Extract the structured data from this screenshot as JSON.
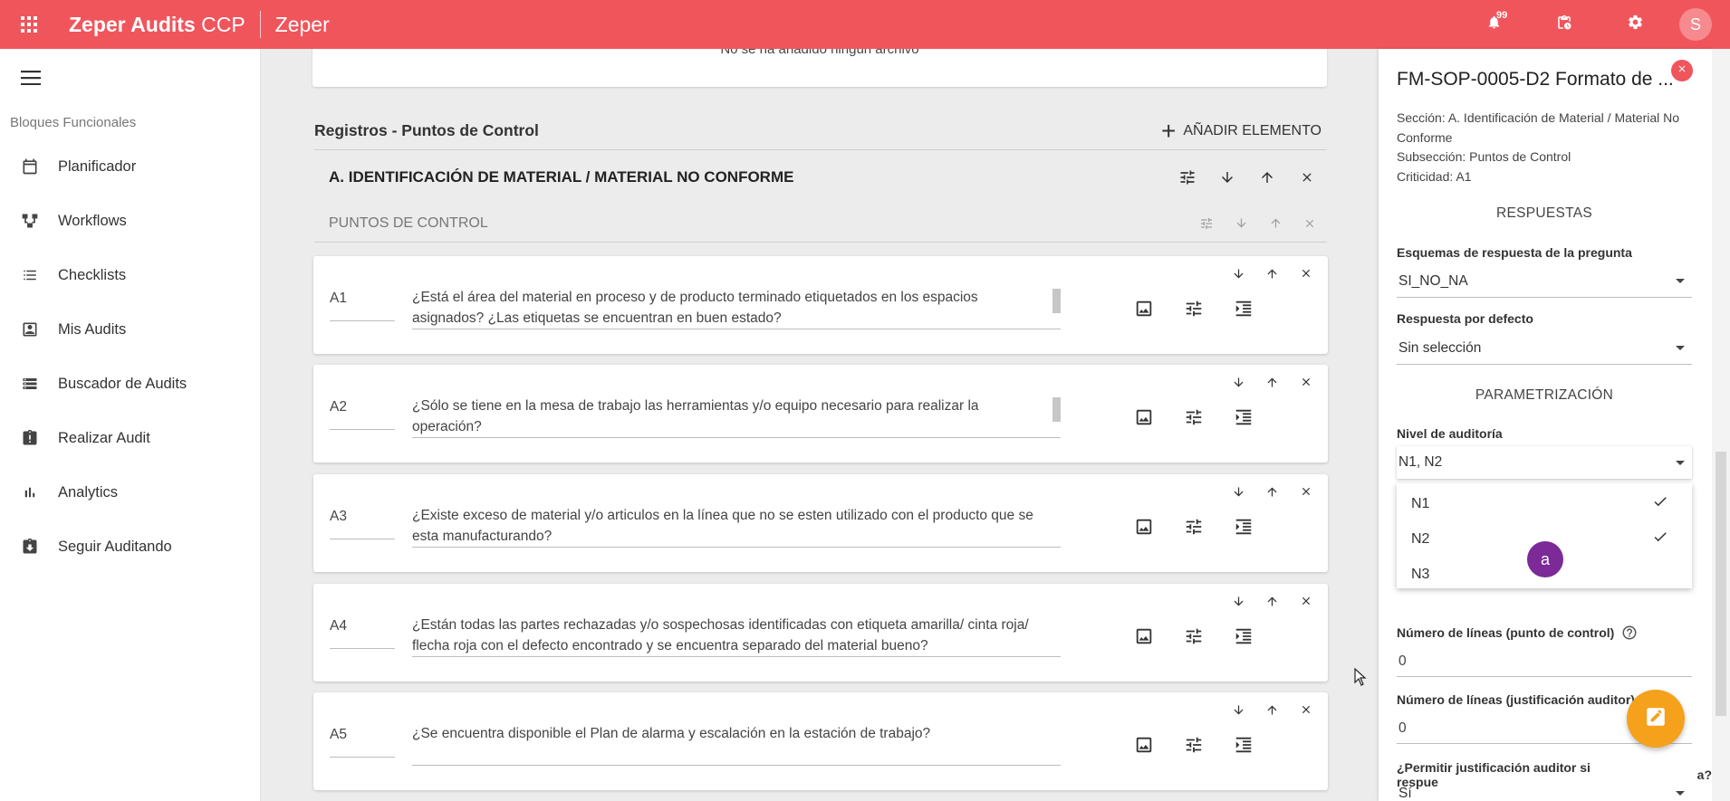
{
  "topbar": {
    "app_name": "Zeper Audits",
    "app_suffix": " CCP",
    "org_name": "Zeper",
    "notifications_count": "99",
    "avatar_initial": "S",
    "color": "#f1555c"
  },
  "sidebar": {
    "section_header": "Bloques Funcionales",
    "items": [
      {
        "label": "Planificador",
        "icon": "calendar-icon"
      },
      {
        "label": "Workflows",
        "icon": "workflow-icon"
      },
      {
        "label": "Checklists",
        "icon": "list-icon"
      },
      {
        "label": "Mis Audits",
        "icon": "account-box-icon"
      },
      {
        "label": "Buscador de Audits",
        "icon": "storage-icon"
      },
      {
        "label": "Realizar Audit",
        "icon": "clipboard-alert-icon"
      },
      {
        "label": "Analytics",
        "icon": "bar-chart-icon"
      },
      {
        "label": "Seguir Auditando",
        "icon": "clipboard-download-icon"
      }
    ]
  },
  "main": {
    "prev_card_message": "No se ha añadido ningún archivo",
    "section_title": "Registros - Puntos de Control",
    "add_button_label": "AÑADIR ELEMENTO",
    "group_title": "A. IDENTIFICACIÓN DE MATERIAL / MATERIAL NO CONFORME",
    "subgroup_title": "PUNTOS DE CONTROL",
    "questions": [
      {
        "code": "A1",
        "text": "¿Está el área del material en proceso y de producto terminado etiquetados en los espacios asignados? ¿Las etiquetas se encuentran en buen estado?"
      },
      {
        "code": "A2",
        "text": "¿Sólo se tiene en la mesa de trabajo las herramientas y/o equipo necesario para realizar la operación?"
      },
      {
        "code": "A3",
        "text": "¿Existe exceso de material y/o articulos en la línea que no se esten utilizado con el producto que se esta manufacturando?"
      },
      {
        "code": "A4",
        "text": "¿Están todas las partes rechazadas y/o sospechosas identificadas con etiqueta amarilla/ cinta roja/ flecha roja con el defecto encontrado y se encuentra separado del material bueno?"
      },
      {
        "code": "A5",
        "text": "¿Se encuentra disponible el Plan de alarma y escalación en la estación de trabajo?"
      }
    ]
  },
  "panel": {
    "title": "FM-SOP-0005-D2 Formato de ...",
    "seccion": "Sección: A. Identificación de Material / Material No Conforme",
    "subseccion": "Subsección: Puntos de Control",
    "criticidad": "Criticidad: A1",
    "respuestas_heading": "RESPUESTAS",
    "esquemas_label": "Esquemas de respuesta de la pregunta",
    "esquemas_value": "SI_NO_NA",
    "respuesta_defecto_label": "Respuesta por defecto",
    "respuesta_defecto_value": "Sin selección",
    "parametrizacion_heading": "PARAMETRIZACIÓN",
    "nivel_label": "Nivel de auditoría",
    "nivel_value": "N1, N2",
    "nivel_options": [
      {
        "label": "N1",
        "checked": true
      },
      {
        "label": "N2",
        "checked": true
      },
      {
        "label": "N3",
        "checked": false
      }
    ],
    "lineas_pc_label": "Número de líneas (punto de control)",
    "lineas_pc_value": "0",
    "lineas_ja_label": "Número de líneas (justificación auditor)",
    "lineas_ja_value": "0",
    "permitir_label": "¿Permitir justificación auditor si respue",
    "permitir_label_end": "a?",
    "permitir_value": "Sí",
    "touch_marker": "a",
    "fab_color": "#f5a11c"
  }
}
